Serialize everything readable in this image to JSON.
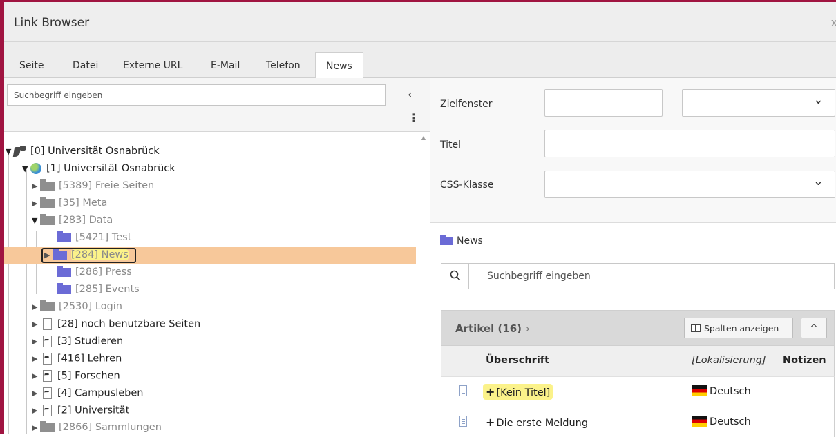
{
  "dialog": {
    "title": "Link Browser",
    "close_symbol": "x"
  },
  "tabs": [
    "Seite",
    "Datei",
    "Externe URL",
    "E-Mail",
    "Telefon",
    "News"
  ],
  "active_tab": "News",
  "page_tree": {
    "search_placeholder": "Suchbegriff eingeben",
    "collapse_symbol": "‹",
    "menu_symbol": "⋮",
    "nodes": [
      {
        "label": "[0] Universität Osnabrück"
      },
      {
        "label": "[1] Universität Osnabrück"
      },
      {
        "label": "[5389] Freie Seiten"
      },
      {
        "label": "[35] Meta"
      },
      {
        "label": "[283] Data"
      },
      {
        "label": "[5421] Test"
      },
      {
        "label": "[284] News",
        "selected": true
      },
      {
        "label": "[286] Press"
      },
      {
        "label": "[285] Events"
      },
      {
        "label": "[2530] Login"
      },
      {
        "label": "[28] noch benutzbare Seiten"
      },
      {
        "label": "[3] Studieren"
      },
      {
        "label": "[416] Lehren"
      },
      {
        "label": "[5] Forschen"
      },
      {
        "label": "[4] Campusleben"
      },
      {
        "label": "[2] Universität"
      },
      {
        "label": "[2866] Sammlungen"
      }
    ]
  },
  "form": {
    "zielfenster_label": "Zielfenster",
    "titel_label": "Titel",
    "css_label": "CSS-Klasse"
  },
  "news_panel": {
    "breadcrumb": "News",
    "search_placeholder": "Suchbegriff eingeben",
    "list_title": "Artikel (16)",
    "list_title_chevron": "›",
    "columns_button": "Spalten anzeigen",
    "collapse_button": "^",
    "columns": {
      "title": "Überschrift",
      "localization": "[Lokalisierung]",
      "notes": "Notizen"
    },
    "rows": [
      {
        "title": "[Kein Titel]",
        "language": "Deutsch"
      },
      {
        "title": "Die erste Meldung",
        "language": "Deutsch"
      }
    ]
  },
  "colors": {
    "accent_border": "#a01441",
    "selected_row": "#f7c89a",
    "highlight": "#fbf28a"
  }
}
